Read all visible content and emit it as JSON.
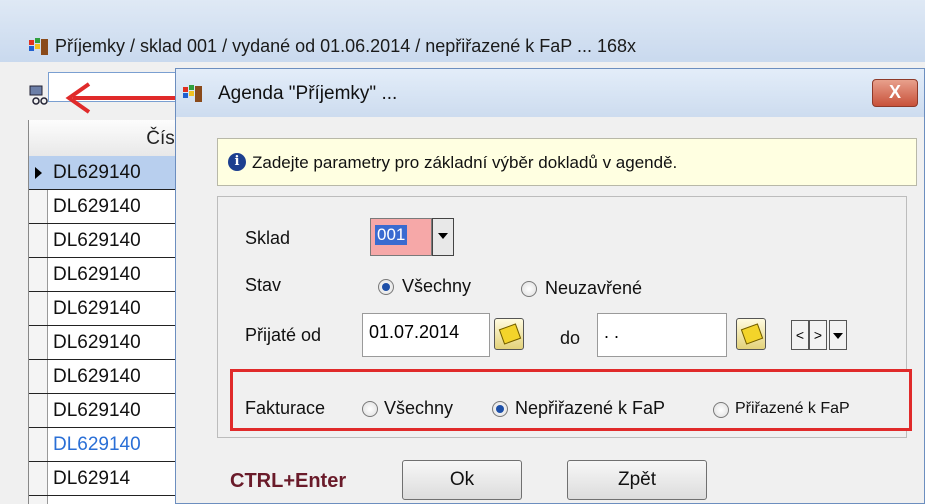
{
  "window": {
    "title": "Příjemky / sklad 001 / vydané od 01.06.2014 / nepřiřazené k FaP ... 168x"
  },
  "grid": {
    "header": "Čísl",
    "rows": [
      "DL629140",
      "DL629140",
      "DL629140",
      "DL629140",
      "DL629140",
      "DL629140",
      "DL629140",
      "DL629140",
      "DL629140",
      "DL62914"
    ]
  },
  "dialog": {
    "title": "Agenda \"Příjemky\" ...",
    "close_label": "X",
    "info_text": "Zadejte parametry pro základní výběr dokladů v agendě.",
    "sklad_label": "Sklad",
    "sklad_value": "001",
    "stav_label": "Stav",
    "stav_options": [
      "Všechny",
      "Neuzavřené"
    ],
    "stav_selected": 0,
    "prijate_od_label": "Přijaté od",
    "date_from": "01.07.2014",
    "do_label": "do",
    "date_to": ". .",
    "nav_prev": "<",
    "nav_next": ">",
    "fakturace_label": "Fakturace",
    "fakturace_options": [
      "Všechny",
      "Nepřiřazené k FaP",
      "Přiřazené k FaP"
    ],
    "fakturace_selected": 1,
    "shortcut_label": "CTRL+Enter",
    "ok_label": "Ok",
    "back_label": "Zpět"
  },
  "colors": {
    "highlight_box": "#e02a2a",
    "shortcut_text": "#6a1b2a",
    "selected_row": "#b8cfee"
  }
}
